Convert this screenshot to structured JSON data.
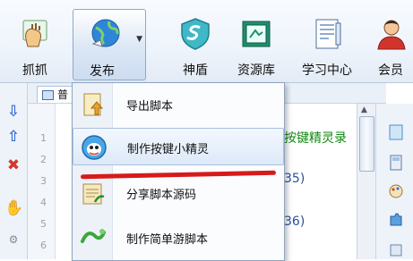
{
  "toolbar": {
    "buttons": [
      {
        "label": "抓抓",
        "icon": "grab-hand-icon"
      },
      {
        "label": "发布",
        "icon": "publish-globe-icon",
        "active": true
      },
      {
        "label": "神盾",
        "icon": "shield-icon"
      },
      {
        "label": "资源库",
        "icon": "resource-library-icon"
      },
      {
        "label": "学习中心",
        "icon": "learning-center-icon"
      },
      {
        "label": "会员",
        "icon": "member-icon"
      }
    ]
  },
  "editor": {
    "tab_label": "普",
    "line_numbers": [
      "1",
      "2",
      "3",
      "4",
      "5",
      "6"
    ],
    "visible_fragments": {
      "line1": "按键精灵录",
      "line3": "35)",
      "line5": "36)"
    }
  },
  "dropdown": {
    "items": [
      {
        "label": "导出脚本",
        "icon": "export-script-icon"
      },
      {
        "label": "制作按键小精灵",
        "icon": "sprite-face-icon",
        "highlighted": true
      },
      {
        "label": "分享脚本源码",
        "icon": "share-source-icon"
      },
      {
        "label": "制作简单游脚本",
        "icon": "simple-game-script-icon"
      }
    ]
  },
  "colors": {
    "accent_red": "#d71a1a",
    "code_green": "#118811",
    "code_blue": "#2a4fa0",
    "menu_border": "#8fa5c2"
  }
}
